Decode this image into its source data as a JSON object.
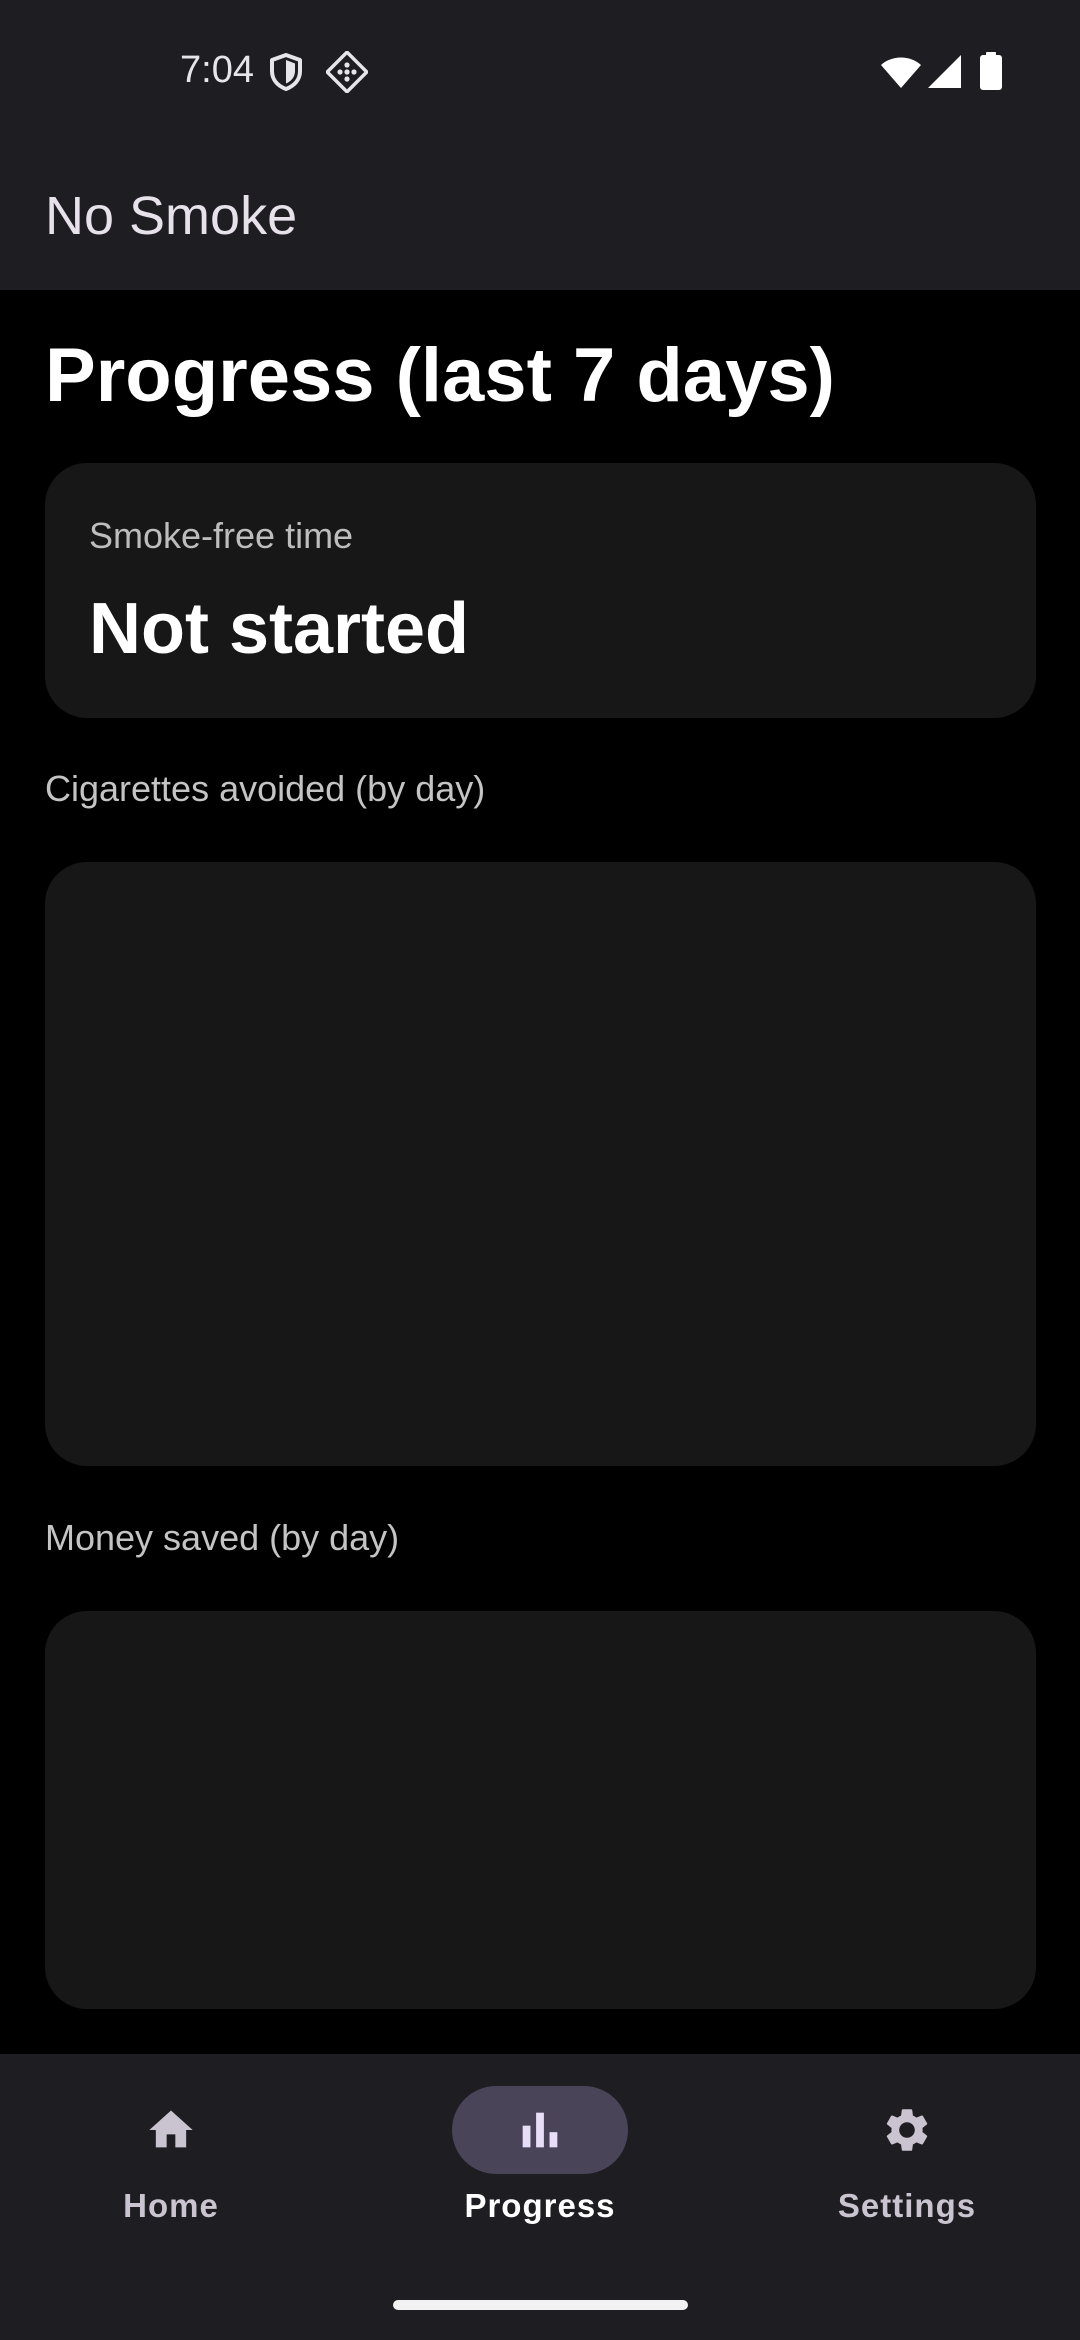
{
  "status_bar": {
    "time": "7:04",
    "icons": [
      "shield-icon",
      "sparkle-grid-icon",
      "wifi-icon",
      "signal-icon",
      "battery-icon"
    ]
  },
  "app_bar": {
    "title": "No Smoke"
  },
  "main": {
    "page_title": "Progress (last 7 days)",
    "smoke_free": {
      "label": "Smoke-free time",
      "value": "Not started"
    },
    "cigarettes_section_label": "Cigarettes avoided (by day)",
    "money_section_label": "Money saved (by day)"
  },
  "bottom_nav": {
    "items": [
      {
        "label": "Home",
        "icon": "home-icon",
        "selected": false
      },
      {
        "label": "Progress",
        "icon": "bar-chart-icon",
        "selected": true
      },
      {
        "label": "Settings",
        "icon": "gear-icon",
        "selected": false
      }
    ]
  },
  "colors": {
    "background": "#000000",
    "bar_surface": "#1d1d22",
    "card_surface": "#171717",
    "selected_pill": "#4a4458",
    "nav_label": "#cac4d0"
  }
}
